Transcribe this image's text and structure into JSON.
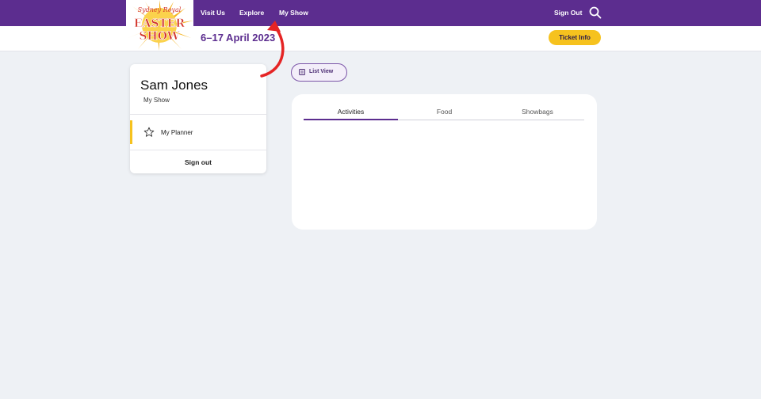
{
  "header": {
    "nav": [
      "Visit Us",
      "Explore",
      "My Show"
    ],
    "sign_out": "Sign Out",
    "dates": "6–17 April 2023",
    "ticket_button": "Ticket Info"
  },
  "logo": {
    "line1": "Sydney Royal",
    "line2": "EASTER",
    "line3": "SHOW"
  },
  "profile": {
    "name": "Sam Jones",
    "subtitle": "My Show",
    "menu_item": "My Planner",
    "sign_out": "Sign out"
  },
  "list_view_button": "List View",
  "tabs": [
    "Activities",
    "Food",
    "Showbags"
  ],
  "colors": {
    "brand_purple": "#5c2d8f",
    "accent_yellow": "#f6c21e",
    "annotation_red": "#e52424",
    "page_bg": "#eef1f5"
  }
}
